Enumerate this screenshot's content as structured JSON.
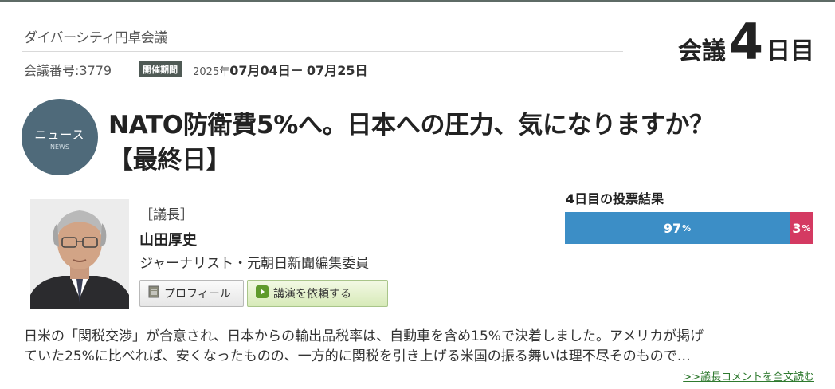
{
  "site": {
    "title": "ダイバーシティ円卓会議"
  },
  "meeting": {
    "number": "会議番号:3779",
    "period_badge": "開催期間",
    "date_year": "2025年",
    "date_start": "07月04日",
    "date_sep": "－",
    "date_end": "07月25日"
  },
  "day_counter": {
    "prefix": "会議",
    "number": "4",
    "suffix": "日目"
  },
  "news_icon": {
    "label_jp": "ニュース",
    "label_en": "NEWS",
    "color": "#4f6a7a"
  },
  "headline": {
    "line1": "NATO防衛費5%へ。日本への圧力、気になりますか？",
    "line2": "【最終日】"
  },
  "chair": {
    "role": "［議長］",
    "name": "山田厚史",
    "title": "ジャーナリスト・元朝日新聞編集委員",
    "profile_button": "プロフィール",
    "lecture_button": "講演を依頼する"
  },
  "vote": {
    "label": "4日目の投票結果",
    "yes_value": 97,
    "no_value": 3,
    "yes_text": "97",
    "no_text": "3",
    "unit": "%",
    "yes_color": "#3c8ec6",
    "no_color": "#d43a62"
  },
  "comment": {
    "line1": "日米の「関税交渉」が合意され、日本からの輸出品税率は、自動車を含め15%で決着しました。アメリカが掲げ",
    "line2": "ていた25%に比べれば、安くなったものの、一方的に関税を引き上げる米国の振る舞いは理不尽そのもので…",
    "read_more": ">>議長コメントを全文読む"
  }
}
